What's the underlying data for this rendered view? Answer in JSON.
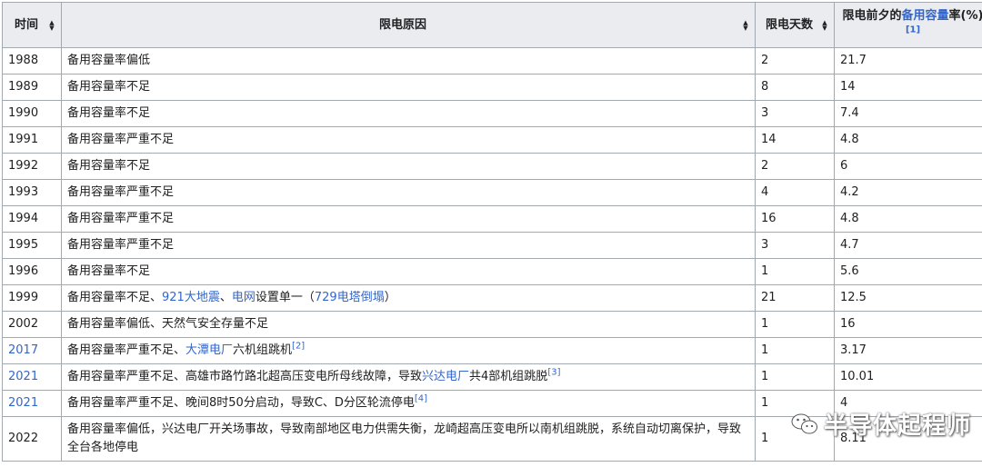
{
  "headers": {
    "year": "时间",
    "reason": "限电原因",
    "days": "限电天数",
    "reserve_prefix": "限电前夕的",
    "reserve_link": "备用容量",
    "reserve_suffix": "率(%)",
    "reserve_ref": "[1]"
  },
  "rows": [
    {
      "year": "1988",
      "days": "2",
      "rate": "21.7",
      "parts": [
        {
          "t": "备用容量率偏低"
        }
      ]
    },
    {
      "year": "1989",
      "days": "8",
      "rate": "14",
      "parts": [
        {
          "t": "备用容量率不足"
        }
      ]
    },
    {
      "year": "1990",
      "days": "3",
      "rate": "7.4",
      "parts": [
        {
          "t": "备用容量率不足"
        }
      ]
    },
    {
      "year": "1991",
      "days": "14",
      "rate": "4.8",
      "parts": [
        {
          "t": "备用容量率严重不足"
        }
      ]
    },
    {
      "year": "1992",
      "days": "2",
      "rate": "6",
      "parts": [
        {
          "t": "备用容量率不足"
        }
      ]
    },
    {
      "year": "1993",
      "days": "4",
      "rate": "4.2",
      "parts": [
        {
          "t": "备用容量率严重不足"
        }
      ]
    },
    {
      "year": "1994",
      "days": "16",
      "rate": "4.8",
      "parts": [
        {
          "t": "备用容量率严重不足"
        }
      ]
    },
    {
      "year": "1995",
      "days": "3",
      "rate": "4.7",
      "parts": [
        {
          "t": "备用容量率严重不足"
        }
      ]
    },
    {
      "year": "1996",
      "days": "1",
      "rate": "5.6",
      "parts": [
        {
          "t": "备用容量率不足"
        }
      ]
    },
    {
      "year": "1999",
      "days": "21",
      "rate": "12.5",
      "parts": [
        {
          "t": "备用容量率不足、"
        },
        {
          "t": "921大地震",
          "link": true
        },
        {
          "t": "、"
        },
        {
          "t": "电网",
          "link": true
        },
        {
          "t": "设置单一（"
        },
        {
          "t": "729电塔倒塌",
          "link": true
        },
        {
          "t": "）"
        }
      ]
    },
    {
      "year": "2002",
      "days": "1",
      "rate": "16",
      "parts": [
        {
          "t": "备用容量率偏低、天然气安全存量不足"
        }
      ]
    },
    {
      "year": "2017",
      "year_link": true,
      "days": "1",
      "rate": "3.17",
      "parts": [
        {
          "t": "备用容量率严重不足、"
        },
        {
          "t": "大潭电厂",
          "link": true
        },
        {
          "t": "六机组跳机"
        },
        {
          "t": "[2]",
          "ref": true
        }
      ]
    },
    {
      "year": "2021",
      "year_link": true,
      "days": "1",
      "rate": "10.01",
      "parts": [
        {
          "t": "备用容量率严重不足、高雄市路竹路北超高压变电所母线故障，导致"
        },
        {
          "t": "兴达电厂",
          "link": true
        },
        {
          "t": "共4部机组跳脱"
        },
        {
          "t": "[3]",
          "ref": true
        }
      ]
    },
    {
      "year": "2021",
      "year_link": true,
      "days": "1",
      "rate": "4",
      "parts": [
        {
          "t": "备用容量率严重不足、晚间8时50分启动，导致C、D分区轮流停电"
        },
        {
          "t": "[4]",
          "ref": true
        }
      ]
    },
    {
      "year": "2022",
      "days": "1",
      "rate": "8.11",
      "tall": true,
      "parts": [
        {
          "t": "备用容量率偏低，兴达电厂开关场事故，导致南部地区电力供需失衡，龙崎超高压变电所以南机组跳脱，系统自动切离保护，导致全台各地停电"
        }
      ]
    }
  ],
  "watermark": {
    "text": "半导体起程师",
    "icon": "wechat-icon"
  }
}
